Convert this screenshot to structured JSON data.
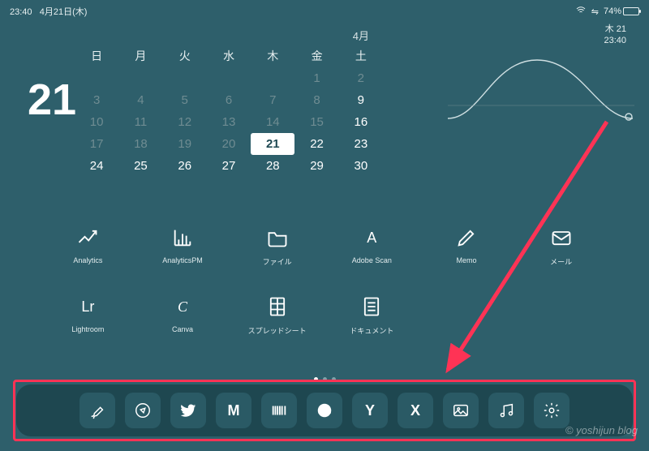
{
  "status": {
    "time": "23:40",
    "date_label": "4月21日(木)",
    "battery_pct": "74%",
    "battery_fill": 74
  },
  "mini_widget": {
    "line1": "木 21",
    "line2": "23:40"
  },
  "big_day": "21",
  "calendar": {
    "month_label": "4月",
    "dow": [
      "日",
      "月",
      "火",
      "水",
      "木",
      "金",
      "土"
    ],
    "rows": [
      [
        {
          "v": ""
        },
        {
          "v": ""
        },
        {
          "v": ""
        },
        {
          "v": ""
        },
        {
          "v": ""
        },
        {
          "v": "1",
          "cls": "other"
        },
        {
          "v": "2",
          "cls": "other"
        }
      ],
      [
        {
          "v": "3",
          "cls": "other"
        },
        {
          "v": "4",
          "cls": "other"
        },
        {
          "v": "5",
          "cls": "other"
        },
        {
          "v": "6",
          "cls": "other"
        },
        {
          "v": "7",
          "cls": "other"
        },
        {
          "v": "8",
          "cls": "other"
        },
        {
          "v": "9",
          "cls": "wk"
        }
      ],
      [
        {
          "v": "10",
          "cls": "other"
        },
        {
          "v": "11",
          "cls": "other"
        },
        {
          "v": "12",
          "cls": "other"
        },
        {
          "v": "13",
          "cls": "other"
        },
        {
          "v": "14",
          "cls": "other"
        },
        {
          "v": "15",
          "cls": "other"
        },
        {
          "v": "16",
          "cls": "wk"
        }
      ],
      [
        {
          "v": "17",
          "cls": "other"
        },
        {
          "v": "18",
          "cls": "other"
        },
        {
          "v": "19",
          "cls": "other"
        },
        {
          "v": "20",
          "cls": "other"
        },
        {
          "v": "21",
          "cls": "today"
        },
        {
          "v": "22",
          "cls": "wk"
        },
        {
          "v": "23",
          "cls": "wk"
        }
      ],
      [
        {
          "v": "24",
          "cls": "wk"
        },
        {
          "v": "25",
          "cls": "wk"
        },
        {
          "v": "26",
          "cls": "wk"
        },
        {
          "v": "27",
          "cls": "wk"
        },
        {
          "v": "28",
          "cls": "wk"
        },
        {
          "v": "29",
          "cls": "wk"
        },
        {
          "v": "30",
          "cls": "wk"
        }
      ]
    ]
  },
  "apps_row1": [
    {
      "name": "analytics",
      "label": "Analytics",
      "icon": "trend"
    },
    {
      "name": "analytics-pm",
      "label": "AnalyticsPM",
      "icon": "bars"
    },
    {
      "name": "files",
      "label": "ファイル",
      "icon": "folder"
    },
    {
      "name": "adobe-scan",
      "label": "Adobe Scan",
      "icon": "letterA"
    },
    {
      "name": "memo",
      "label": "Memo",
      "icon": "pencil"
    },
    {
      "name": "mail",
      "label": "メール",
      "icon": "mail"
    }
  ],
  "apps_row2": [
    {
      "name": "lightroom",
      "label": "Lightroom",
      "icon": "textLr"
    },
    {
      "name": "canva",
      "label": "Canva",
      "icon": "textC"
    },
    {
      "name": "sheets",
      "label": "スプレッドシート",
      "icon": "sheet"
    },
    {
      "name": "documents",
      "label": "ドキュメント",
      "icon": "doc"
    }
  ],
  "dock": [
    {
      "name": "procreate",
      "icon": "brush"
    },
    {
      "name": "safari",
      "icon": "compass"
    },
    {
      "name": "twitter",
      "icon": "twitter"
    },
    {
      "name": "gmail",
      "icon": "letterM"
    },
    {
      "name": "barcode",
      "icon": "barcode"
    },
    {
      "name": "line",
      "icon": "line"
    },
    {
      "name": "yahoo",
      "icon": "letterY"
    },
    {
      "name": "x-app",
      "icon": "letterX"
    },
    {
      "name": "photos",
      "icon": "image"
    },
    {
      "name": "music",
      "icon": "music"
    },
    {
      "name": "settings",
      "icon": "gear"
    }
  ],
  "watermark": "© yoshijun blog"
}
